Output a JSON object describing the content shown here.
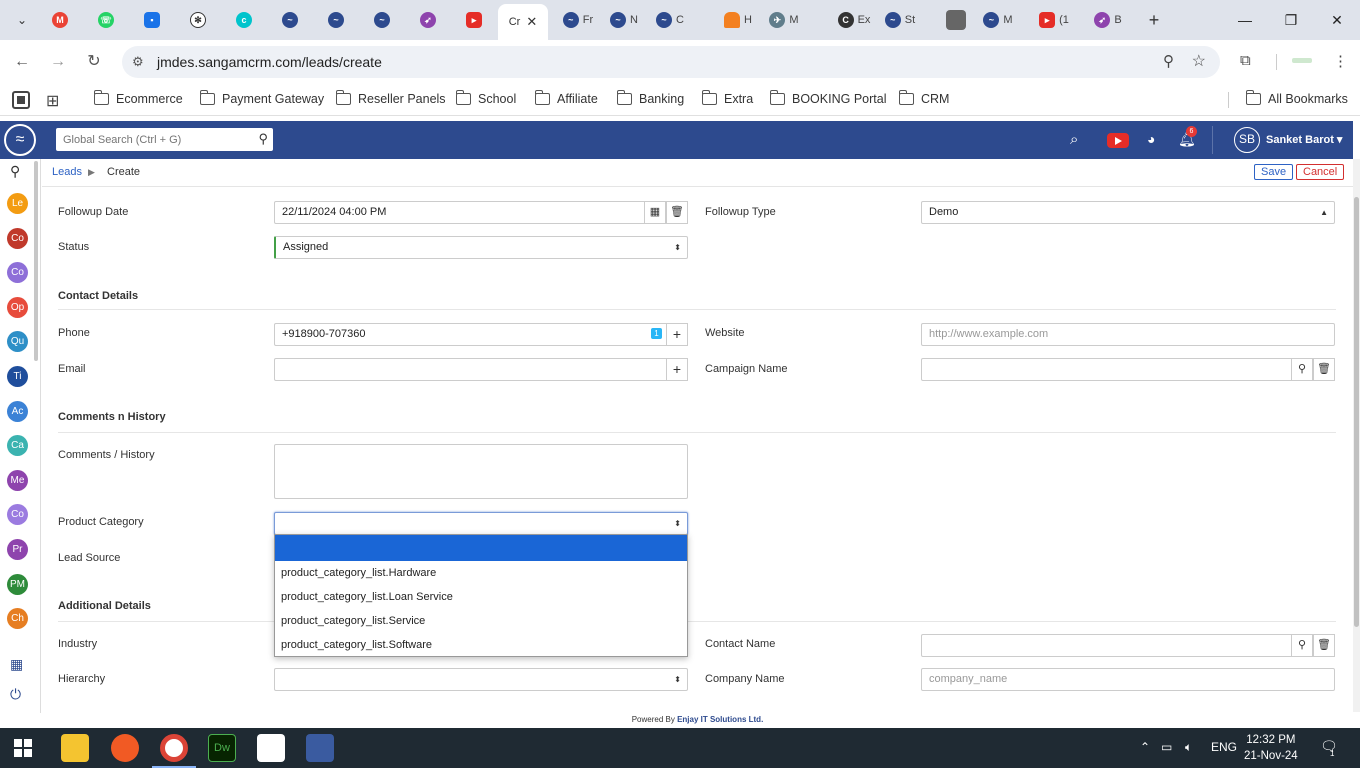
{
  "browser": {
    "active_tab_title": "Cr",
    "tabs": [
      {
        "icon": "chevron-down-icon",
        "title": ""
      },
      {
        "icon": "gmail-icon",
        "title": ""
      },
      {
        "icon": "whatsapp-icon",
        "title": ""
      },
      {
        "icon": "chat-icon",
        "title": ""
      },
      {
        "icon": "openai-icon",
        "title": ""
      },
      {
        "icon": "canva-icon",
        "title": ""
      },
      {
        "icon": "sangam-icon",
        "title": ""
      },
      {
        "icon": "sangam-icon",
        "title": ""
      },
      {
        "icon": "sangam-icon",
        "title": ""
      },
      {
        "icon": "rocket-icon",
        "title": ""
      },
      {
        "icon": "youtube-icon",
        "title": ""
      },
      {
        "icon": "sangam-icon",
        "title": "Fr"
      },
      {
        "icon": "sangam-icon",
        "title": "N"
      },
      {
        "icon": "sangam-icon",
        "title": "C"
      },
      {
        "icon": "cloudflare-icon",
        "title": "H"
      },
      {
        "icon": "bird-icon",
        "title": "M"
      },
      {
        "icon": "edge-icon",
        "title": "Ex"
      },
      {
        "icon": "sangam-icon",
        "title": "St"
      },
      {
        "icon": "gray-square-icon",
        "title": ""
      },
      {
        "icon": "sangam-icon",
        "title": "M"
      },
      {
        "icon": "youtube-icon",
        "title": "(1"
      },
      {
        "icon": "rocket-icon",
        "title": "B"
      }
    ],
    "url": "jmdes.sangamcrm.com/leads/create",
    "bookmarks": [
      "Ecommerce",
      "Payment Gateway",
      "Reseller Panels",
      "School",
      "Affiliate",
      "Banking",
      "Extra",
      "BOOKING Portal",
      "CRM"
    ],
    "all_bookmarks": "All Bookmarks"
  },
  "app": {
    "search_placeholder": "Global Search (Ctrl + G)",
    "notification_count": "6",
    "user_initials": "SB",
    "user_name": "Sanket Barot ▾",
    "sidebar_modules": [
      {
        "abbr": "Le",
        "color": "#f39c12"
      },
      {
        "abbr": "Co",
        "color": "#c0392b"
      },
      {
        "abbr": "Co",
        "color": "#8e6fd8"
      },
      {
        "abbr": "Op",
        "color": "#e74c3c"
      },
      {
        "abbr": "Qu",
        "color": "#2e8fc7"
      },
      {
        "abbr": "Ti",
        "color": "#1f4e9c"
      },
      {
        "abbr": "Ac",
        "color": "#3b82d6"
      },
      {
        "abbr": "Ca",
        "color": "#3bb3b0"
      },
      {
        "abbr": "Me",
        "color": "#8e44ad"
      },
      {
        "abbr": "Co",
        "color": "#9b7be0"
      },
      {
        "abbr": "Pr",
        "color": "#8e44ad"
      },
      {
        "abbr": "PM",
        "color": "#2e8b3a"
      },
      {
        "abbr": "Ch",
        "color": "#e67e22"
      }
    ]
  },
  "breadcrumb": {
    "module": "Leads",
    "separator": "▶",
    "page": "Create"
  },
  "actions": {
    "save": "Save",
    "cancel": "Cancel"
  },
  "form": {
    "followup_date": {
      "label": "Followup Date",
      "value": "22/11/2024 04:00 PM"
    },
    "followup_type": {
      "label": "Followup Type",
      "value": "Demo"
    },
    "status": {
      "label": "Status",
      "value": "Assigned"
    },
    "contact_section": "Contact Details",
    "phone": {
      "label": "Phone",
      "value": "+918900-707360",
      "chip": "1"
    },
    "website": {
      "label": "Website",
      "placeholder": "http://www.example.com"
    },
    "email": {
      "label": "Email",
      "value": ""
    },
    "campaign": {
      "label": "Campaign Name",
      "value": ""
    },
    "comments_section": "Comments n History",
    "comments": {
      "label": "Comments / History"
    },
    "product_category": {
      "label": "Product Category",
      "value": ""
    },
    "lead_source": {
      "label": "Lead Source"
    },
    "additional_section": "Additional Details",
    "industry": {
      "label": "Industry"
    },
    "contact_name": {
      "label": "Contact Name",
      "value": ""
    },
    "hierarchy": {
      "label": "Hierarchy",
      "value": ""
    },
    "company_name": {
      "label": "Company Name",
      "placeholder": "company_name"
    }
  },
  "dropdown_options": [
    "",
    "product_category_list.Hardware",
    "product_category_list.Loan Service",
    "product_category_list.Service",
    "product_category_list.Software"
  ],
  "footer": {
    "prefix": "Powered By",
    "company": "Enjay IT Solutions Ltd."
  },
  "taskbar": {
    "lang": "ENG",
    "time": "12:32 PM",
    "date": "21-Nov-24",
    "notif": "1"
  }
}
